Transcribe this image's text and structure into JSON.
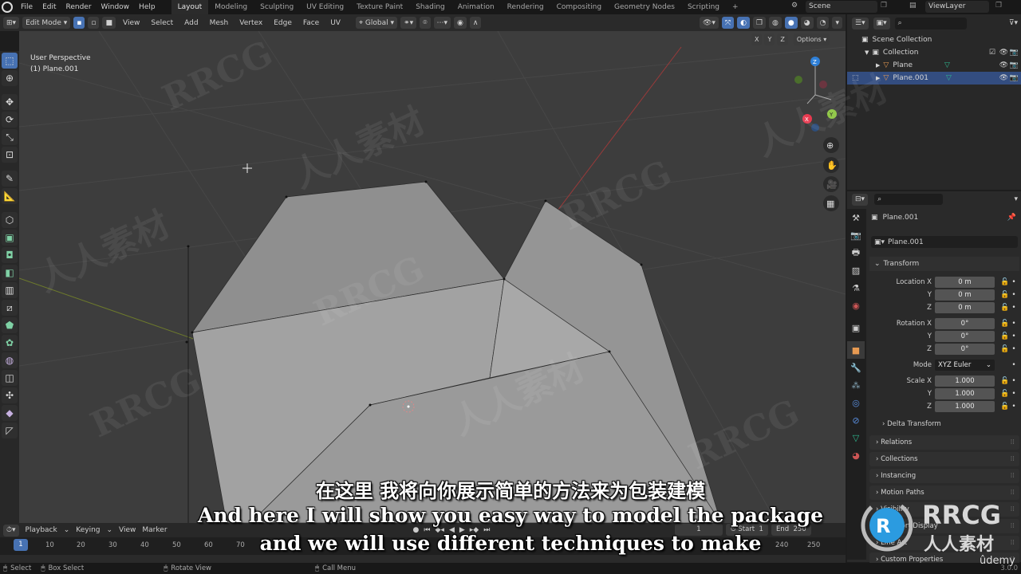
{
  "topbar": {
    "menus": [
      "File",
      "Edit",
      "Render",
      "Window",
      "Help"
    ],
    "workspaces": [
      "Layout",
      "Modeling",
      "Sculpting",
      "UV Editing",
      "Texture Paint",
      "Shading",
      "Animation",
      "Rendering",
      "Compositing",
      "Geometry Nodes",
      "Scripting"
    ],
    "active_workspace": "Layout",
    "add_workspace": "+",
    "scene": "Scene",
    "view_layer": "ViewLayer"
  },
  "viewport_header": {
    "mode": "Edit Mode",
    "menus": [
      "View",
      "Select",
      "Add",
      "Mesh",
      "Vertex",
      "Edge",
      "Face",
      "UV"
    ],
    "orientation": "Global",
    "options_label": "Options",
    "axes": [
      "X",
      "Y",
      "Z"
    ]
  },
  "viewport": {
    "perspective": "User Perspective",
    "object": "(1) Plane.001",
    "gizmo_axes": [
      "Z",
      "Y",
      "X"
    ],
    "colors": {
      "x_axis": "#e8394f",
      "y_axis": "#8bc53f",
      "z_axis": "#2f80d8",
      "mesh_face": "#9d9d9d",
      "background": "#3d3d3d"
    }
  },
  "outliner": {
    "scene_collection": "Scene Collection",
    "collection": "Collection",
    "items": [
      {
        "name": "Plane",
        "selected": false
      },
      {
        "name": "Plane.001",
        "selected": true
      }
    ]
  },
  "properties": {
    "object_name": "Plane.001",
    "datablock_name": "Plane.001",
    "transform_label": "Transform",
    "location": {
      "label": "Location X",
      "x": "0 m",
      "y": "0 m",
      "z": "0 m"
    },
    "rotation": {
      "label": "Rotation X",
      "x": "0°",
      "y": "0°",
      "z": "0°"
    },
    "mode": {
      "label": "Mode",
      "value": "XYZ Euler"
    },
    "scale": {
      "label": "Scale X",
      "x": "1.000",
      "y": "1.000",
      "z": "1.000"
    },
    "axis_y": "Y",
    "axis_z": "Z",
    "delta_transform": "Delta Transform",
    "panels": [
      "Relations",
      "Collections",
      "Instancing",
      "Motion Paths",
      "Visibility",
      "Viewport Display",
      "Line Art",
      "Custom Properties"
    ]
  },
  "timeline": {
    "menus": [
      "Playback",
      "Keying",
      "View",
      "Marker"
    ],
    "current_frame": "1",
    "frame_ticks": [
      "10",
      "20",
      "30",
      "40",
      "50",
      "60",
      "70",
      "240",
      "250"
    ],
    "frame_field": "1",
    "start_label": "Start",
    "start": "1",
    "end_label": "End",
    "end": "250"
  },
  "statusbar": {
    "select": "Select",
    "box_select": "Box Select",
    "rotate_view": "Rotate View",
    "call_menu": "Call Menu",
    "version": "3.0.0"
  },
  "subtitles": {
    "chinese": "在这里 我将向你展示简单的方法来为包装建模",
    "line1": "And here I will show you easy way to model the package",
    "line2": "and we will use different techniques to make"
  },
  "watermark": {
    "brand": "RRCG",
    "brand_cn": "人人素材",
    "udemy": "ûdemy"
  }
}
